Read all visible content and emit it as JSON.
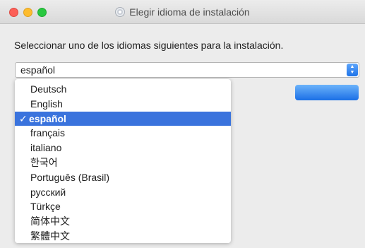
{
  "window": {
    "title": "Elegir idioma de instalación",
    "title_icon": "installer-disc-icon"
  },
  "dialog": {
    "prompt": "Seleccionar uno de los idiomas siguientes para la instalación."
  },
  "language_select": {
    "value": "español",
    "options": [
      "Deutsch",
      "English",
      "español",
      "français",
      "italiano",
      "한국어",
      "Português (Brasil)",
      "русский",
      "Türkçe",
      "简体中文",
      "繁體中文"
    ],
    "selected_index": 2,
    "check_mark": "✓"
  },
  "colors": {
    "selection": "#3a73dd",
    "accent": "#1f74e8"
  }
}
